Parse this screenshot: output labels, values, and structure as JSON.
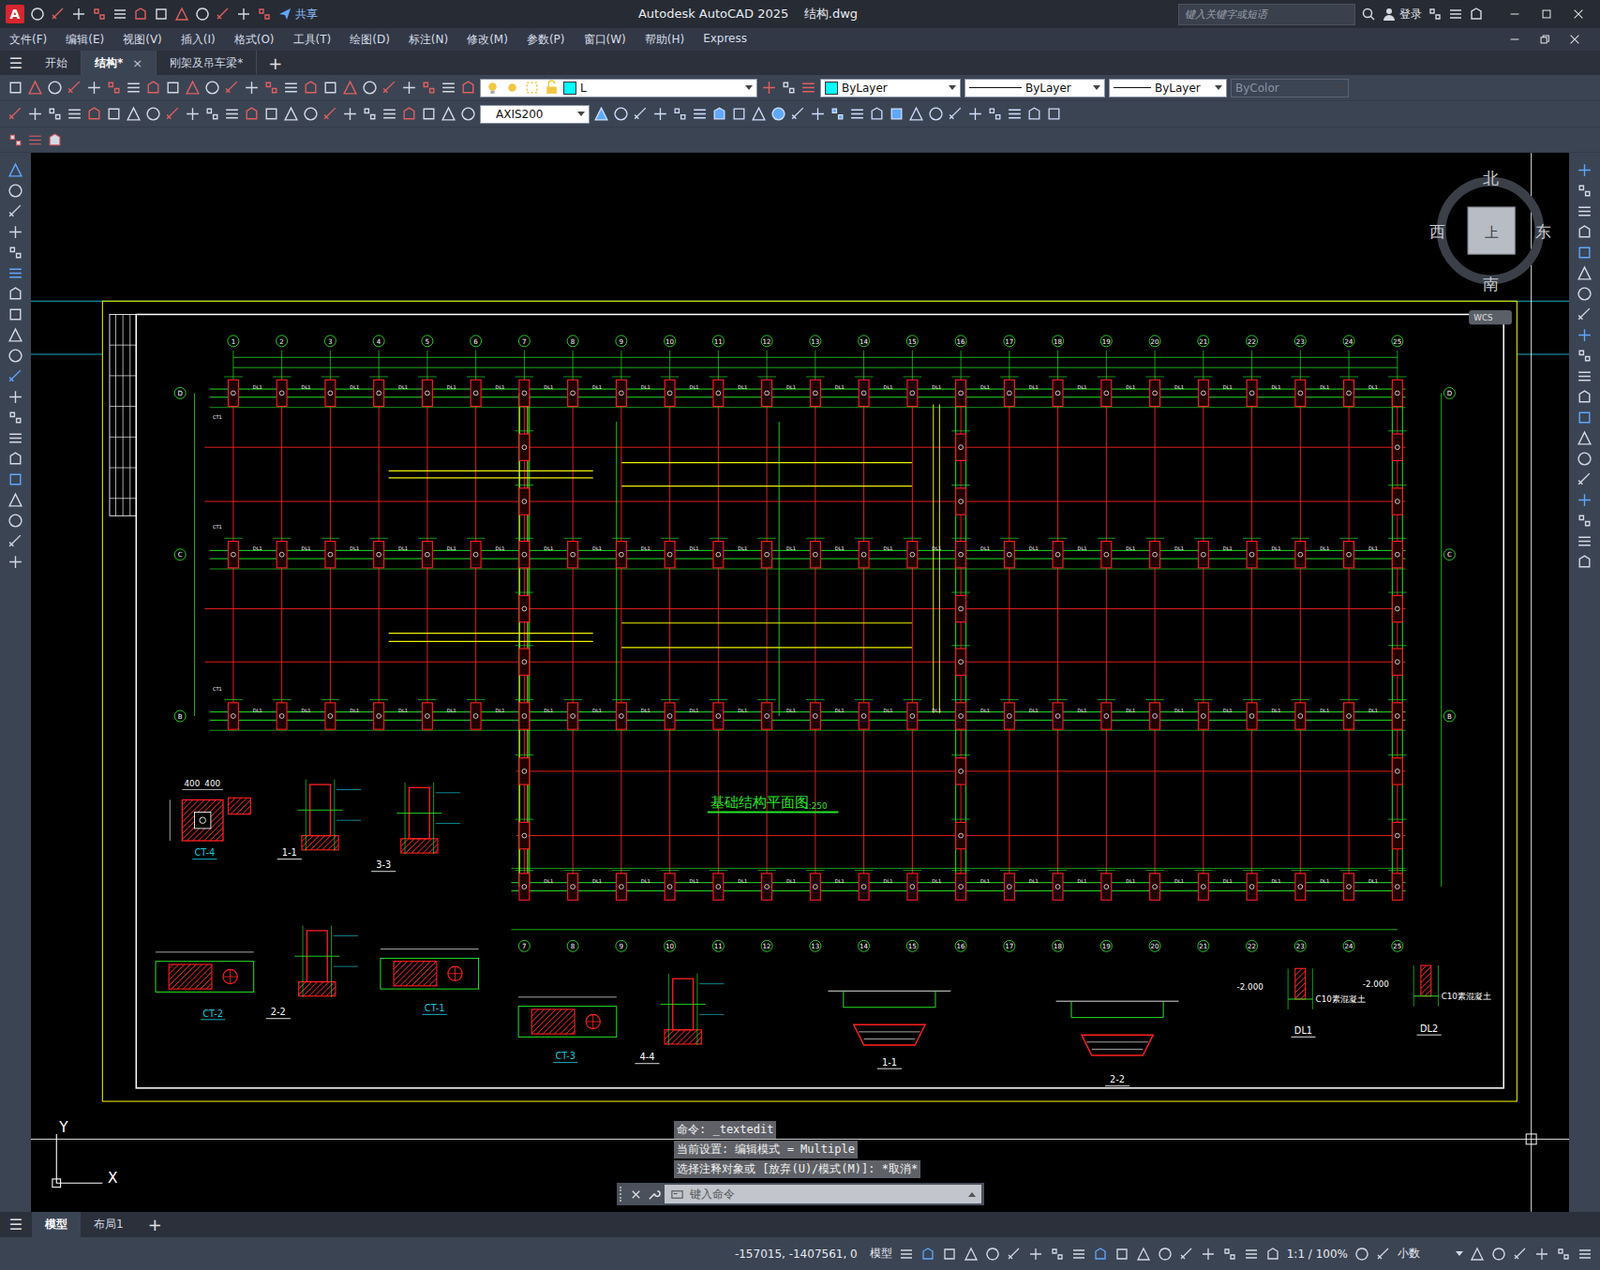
{
  "window": {
    "logo": "A",
    "title": "Autodesk AutoCAD 2025    结构.dwg",
    "share": "共享",
    "search_placeholder": "键入关键字或短语",
    "login": "登录"
  },
  "menu": [
    "文件(F)",
    "编辑(E)",
    "视图(V)",
    "插入(I)",
    "格式(O)",
    "工具(T)",
    "绘图(D)",
    "标注(N)",
    "修改(M)",
    "参数(P)",
    "窗口(W)",
    "帮助(H)",
    "Express"
  ],
  "doc_tabs": {
    "menu_icon": "☰",
    "add": "+",
    "close": "×",
    "items": [
      {
        "label": "开始",
        "selected": false,
        "closable": false
      },
      {
        "label": "结构*",
        "selected": true,
        "closable": true
      },
      {
        "label": "刚架及吊车梁*",
        "selected": false,
        "closable": false
      }
    ]
  },
  "toolbar": {
    "layer": "L",
    "color": "ByLayer",
    "linetype": "ByLayer",
    "lineweight": "ByLayer",
    "plotstyle": "ByColor",
    "plotstyle_disabled": true,
    "dimstyle": "AXIS200"
  },
  "viewcube": {
    "north": "北",
    "south": "南",
    "east": "东",
    "west": "西",
    "top": "上",
    "wcs": "WCS"
  },
  "ucs": {
    "x": "X",
    "y": "Y"
  },
  "plan": {
    "title": "基础结构平面图",
    "scale": "1:250",
    "beam_label": "DL1",
    "pad_label": "CT1",
    "rows": [
      "D",
      "C",
      "B"
    ],
    "columns": [
      {
        "label": "1",
        "bottom": false
      },
      {
        "label": "2",
        "bottom": false
      },
      {
        "label": "3",
        "bottom": false
      },
      {
        "label": "4",
        "bottom": false
      },
      {
        "label": "5",
        "bottom": false
      },
      {
        "label": "6",
        "bottom": false
      },
      {
        "label": "7",
        "bottom": true
      },
      {
        "label": "8",
        "bottom": true
      },
      {
        "label": "9",
        "bottom": true
      },
      {
        "label": "10",
        "bottom": true
      },
      {
        "label": "11",
        "bottom": true
      },
      {
        "label": "12",
        "bottom": true
      },
      {
        "label": "13",
        "bottom": true
      },
      {
        "label": "14",
        "bottom": true
      },
      {
        "label": "15",
        "bottom": true
      },
      {
        "label": "16",
        "bottom": true
      },
      {
        "label": "17",
        "bottom": true
      },
      {
        "label": "18",
        "bottom": true
      },
      {
        "label": "19",
        "bottom": true
      },
      {
        "label": "20",
        "bottom": true
      },
      {
        "label": "21",
        "bottom": true
      },
      {
        "label": "22",
        "bottom": true
      },
      {
        "label": "23",
        "bottom": true
      },
      {
        "label": "24",
        "bottom": true
      },
      {
        "label": "25",
        "bottom": true
      }
    ]
  },
  "details": [
    {
      "label": "CT-4",
      "kind": "pad",
      "notes": [
        "400",
        "400"
      ]
    },
    {
      "label": "1-1",
      "kind": "section",
      "notes": []
    },
    {
      "label": "3-3",
      "kind": "section",
      "notes": []
    },
    {
      "label": "CT-2",
      "kind": "beam",
      "notes": []
    },
    {
      "label": "2-2",
      "kind": "section",
      "notes": []
    },
    {
      "label": "CT-1",
      "kind": "beam",
      "notes": []
    },
    {
      "label": "CT-3",
      "kind": "beam",
      "notes": []
    },
    {
      "label": "4-4",
      "kind": "section",
      "notes": []
    },
    {
      "label": "1-1",
      "kind": "trench",
      "notes": []
    },
    {
      "label": "2-2",
      "kind": "trench",
      "notes": []
    },
    {
      "label": "DL1",
      "kind": "strip",
      "notes": [
        "-2.000",
        "C10素混凝土"
      ]
    },
    {
      "label": "DL2",
      "kind": "strip",
      "notes": [
        "-2.000",
        "C10素混凝土"
      ]
    }
  ],
  "command": {
    "history": [
      "命令: _textedit",
      "当前设置: 编辑模式 = Multiple",
      "选择注释对象或 [放弃(U)/模式(M)]: *取消*"
    ],
    "placeholder": "键入命令"
  },
  "layout_tabs": {
    "menu_icon": "☰",
    "add": "+",
    "items": [
      {
        "label": "模型",
        "selected": true
      },
      {
        "label": "布局1",
        "selected": false
      }
    ]
  },
  "status": {
    "coords": "-157015, -1407561, 0",
    "space": "模型",
    "scale": "1:1 / 100%",
    "units": "小数"
  }
}
